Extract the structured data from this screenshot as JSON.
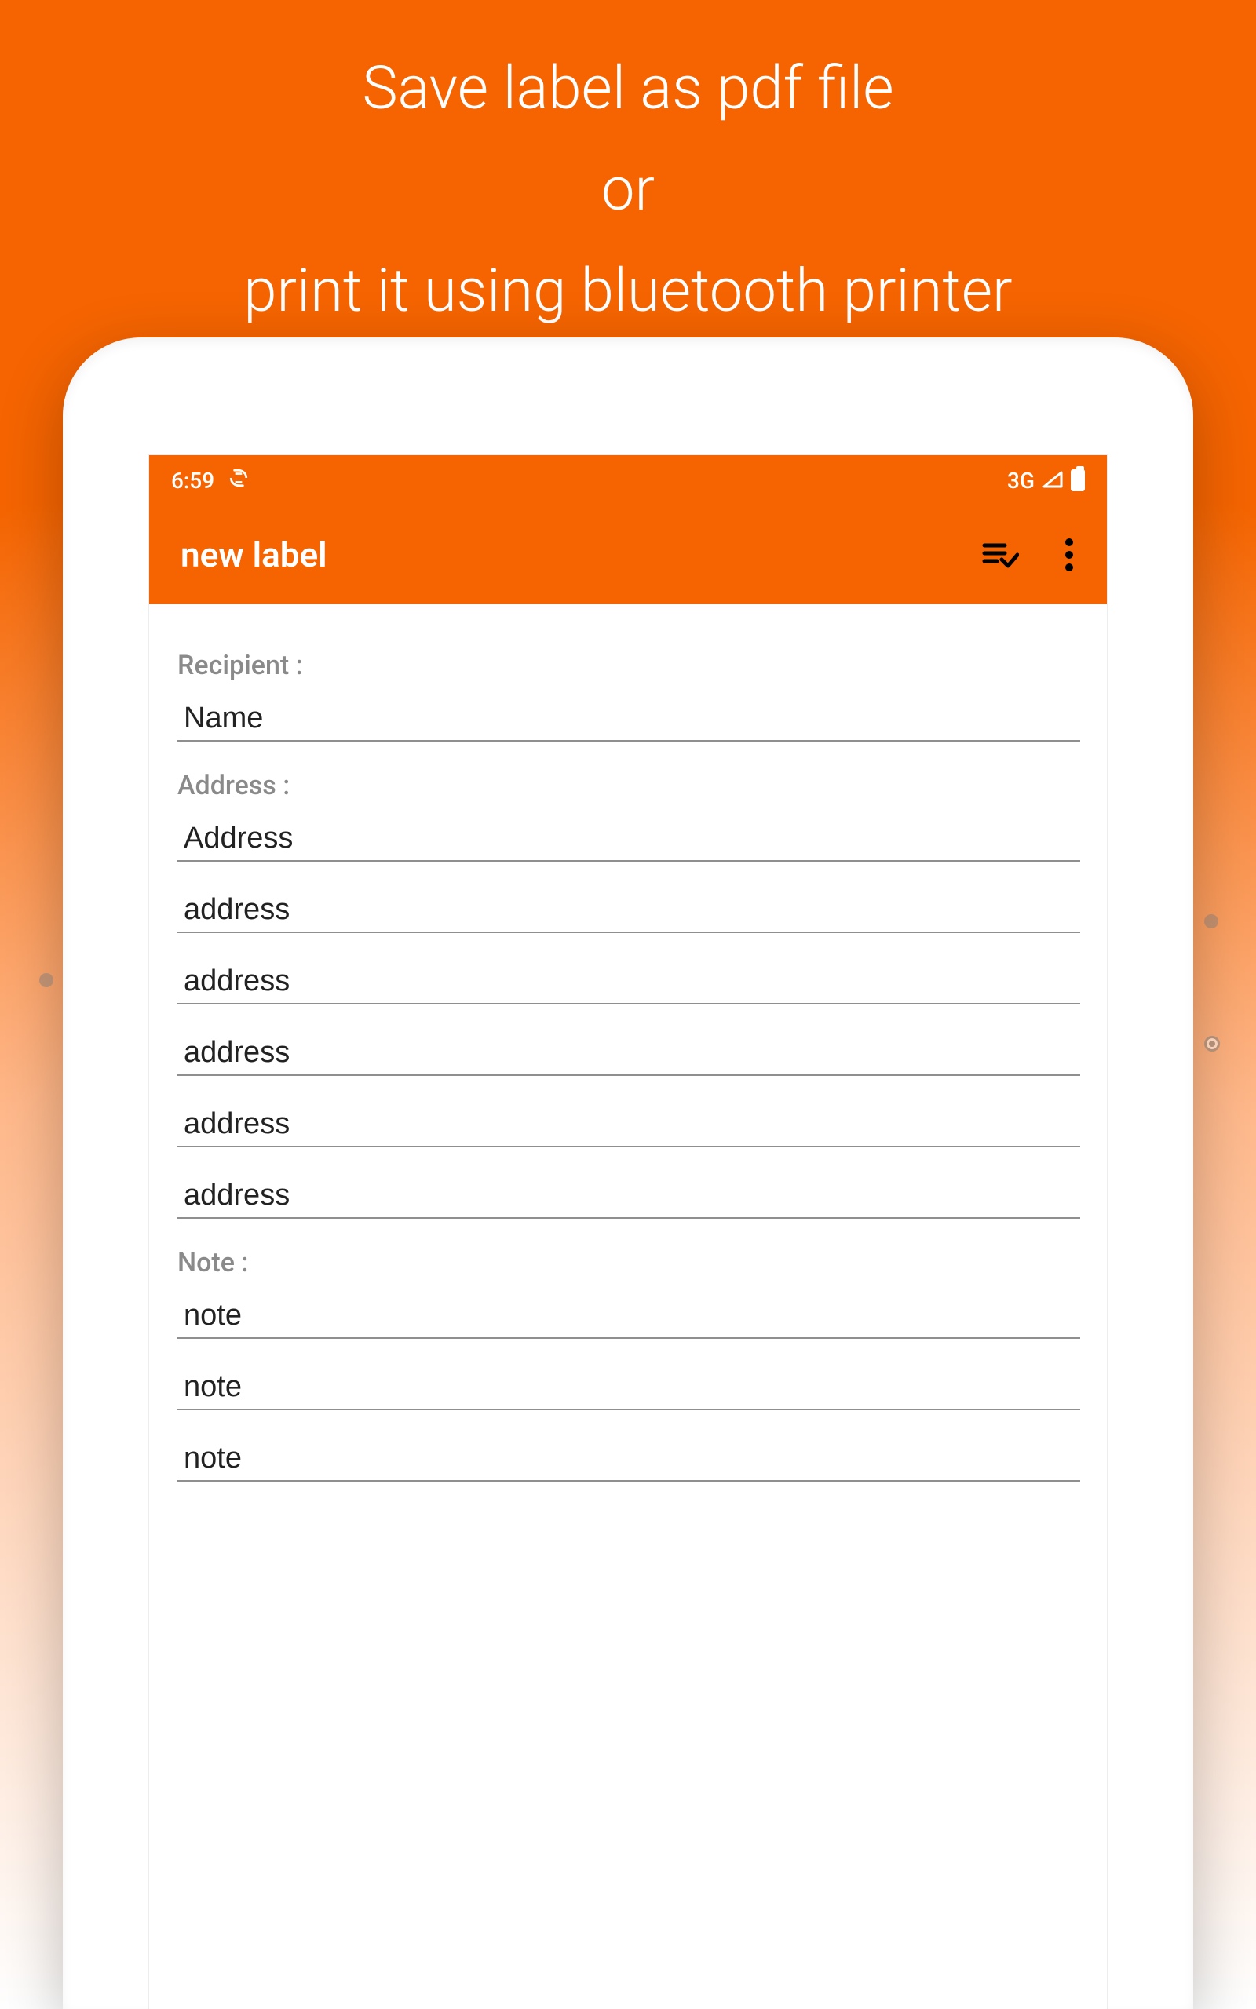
{
  "colors": {
    "accent": "#f56400"
  },
  "promo": {
    "line1": "Save label as pdf file",
    "line2": "or",
    "line3": "print it using bluetooth printer"
  },
  "status_bar": {
    "time": "6:59",
    "network": "3G"
  },
  "app_bar": {
    "title": "new label"
  },
  "form": {
    "recipient_label": "Recipient :",
    "recipient_placeholder": "Name",
    "address_label": "Address :",
    "address_placeholders": [
      "Address",
      "address",
      "address",
      "address",
      "address",
      "address"
    ],
    "note_label": "Note :",
    "note_placeholders": [
      "note",
      "note",
      "note"
    ]
  }
}
